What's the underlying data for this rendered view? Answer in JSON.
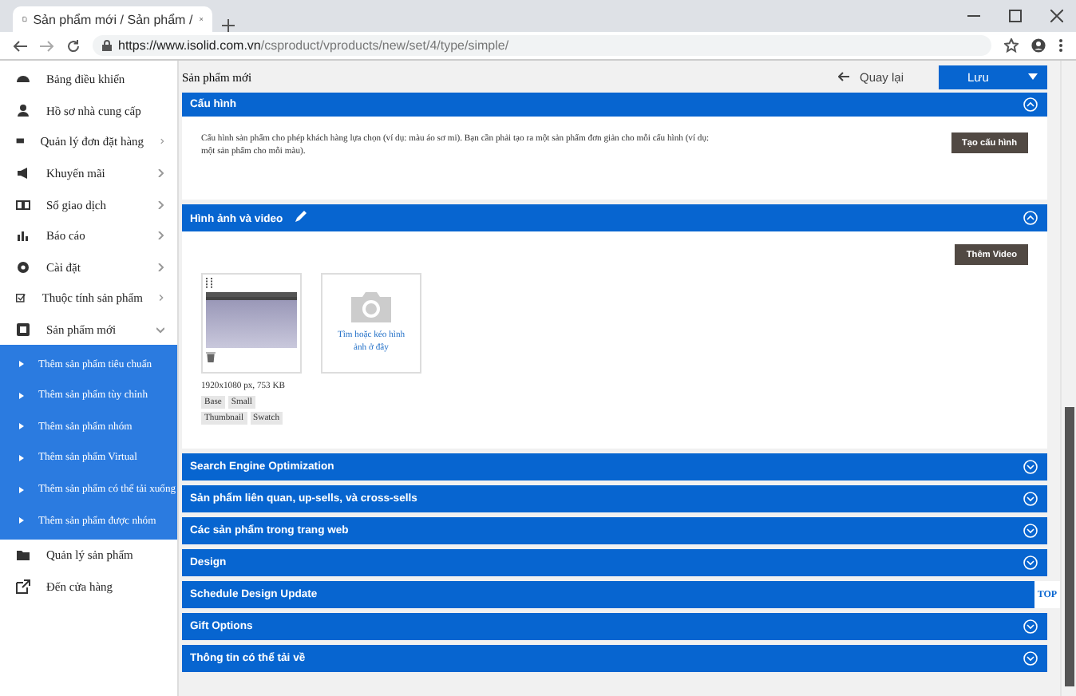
{
  "browser": {
    "tab_title": "Sản phẩm mới / Sản phẩm /",
    "url_scheme": "https://www.isolid.com.vn",
    "url_path": "/csproduct/vproducts/new/set/4/type/simple/"
  },
  "sidebar": {
    "items": [
      {
        "label": "Bảng điều khiển"
      },
      {
        "label": "Hồ sơ nhà cung cấp"
      },
      {
        "label": "Quản lý đơn đặt hàng",
        "expanded": false
      },
      {
        "label": "Khuyến mãi",
        "expanded": false
      },
      {
        "label": "Sổ giao dịch",
        "expanded": false
      },
      {
        "label": "Báo cáo",
        "expanded": false
      },
      {
        "label": "Cài đặt",
        "expanded": false
      },
      {
        "label": "Thuộc tính sản phẩm",
        "expanded": false
      },
      {
        "label": "Sản phẩm mới",
        "expanded": true,
        "children": [
          {
            "label": "Thêm sản phẩm tiêu chuẩn"
          },
          {
            "label": "Thêm sản phẩm tùy chỉnh"
          },
          {
            "label": "Thêm sản phẩm nhóm"
          },
          {
            "label": "Thêm sản phẩm Virtual"
          },
          {
            "label": "Thêm sản phẩm có thể tải xuống"
          },
          {
            "label": "Thêm sản phẩm được nhóm"
          }
        ]
      },
      {
        "label": "Quản lý sản phẩm"
      },
      {
        "label": "Đến cửa hàng"
      }
    ]
  },
  "header": {
    "title": "Sản phẩm mới",
    "back": "Quay lại",
    "save": "Lưu"
  },
  "sections": [
    {
      "kind": "config",
      "title": "Cấu hình",
      "expanded": true,
      "text": "Cấu hình sản phẩm cho phép khách hàng lựa chọn (ví dụ: màu áo sơ mi). Bạn cần phải tạo ra một sản phẩm đơn giản cho mỗi cấu hình (ví dụ: một sản phẩm cho mỗi màu).",
      "button": "Tạo cấu hình"
    },
    {
      "kind": "media",
      "title": "Hình ảnh và video",
      "expanded": true,
      "button": "Thêm Video",
      "image_info": "1920x1080 px, 753 KB",
      "roles": [
        "Base",
        "Small",
        "Thumbnail",
        "Swatch"
      ],
      "upload_hint": "Tìm hoặc kéo hình ảnh ở đây"
    },
    {
      "kind": "plain",
      "title": "Search Engine Optimization",
      "expanded": false
    },
    {
      "kind": "plain",
      "title": "Sản phẩm liên quan, up-sells, và cross-sells",
      "expanded": false
    },
    {
      "kind": "plain",
      "title": "Các sản phẩm trong trang web",
      "expanded": false
    },
    {
      "kind": "plain",
      "title": "Design",
      "expanded": false
    },
    {
      "kind": "plain",
      "title": "Schedule Design Update",
      "top_label": "TOP"
    },
    {
      "kind": "plain",
      "title": "Gift Options",
      "expanded": false
    },
    {
      "kind": "plain",
      "title": "Thông tin có thể tải về",
      "expanded": false
    }
  ]
}
